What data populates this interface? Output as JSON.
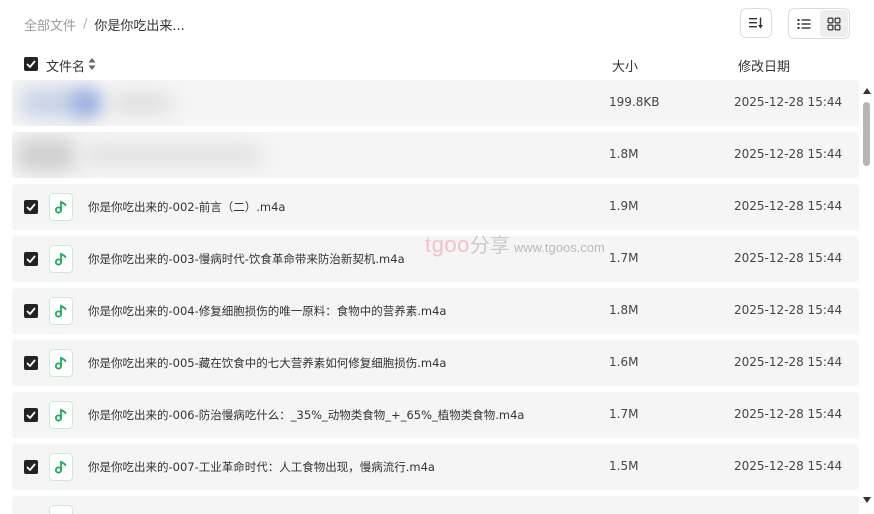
{
  "breadcrumb": {
    "root": "全部文件",
    "separator": "/",
    "current": "你是你吃出来..."
  },
  "columns": {
    "name": "文件名",
    "size": "大小",
    "date": "修改日期"
  },
  "watermark": {
    "logo": "tgoo",
    "cn": "分享",
    "url": "www.tgoos.com"
  },
  "colors": {
    "accent_green": "#1aad5b",
    "row_bg": "#f5f5f5",
    "checkbox": "#222222"
  },
  "rows": [
    {
      "name": "",
      "size": "199.8KB",
      "date": "2025-12-28 15:44",
      "checked": false,
      "blurred": true
    },
    {
      "name": "",
      "size": "1.8M",
      "date": "2025-12-28 15:44",
      "checked": false,
      "blurred": true
    },
    {
      "name": "你是你吃出来的-002-前言（二）.m4a",
      "size": "1.9M",
      "date": "2025-12-28 15:44",
      "checked": true
    },
    {
      "name": "你是你吃出来的-003-慢病时代-饮食革命带来防治新契机.m4a",
      "size": "1.7M",
      "date": "2025-12-28 15:44",
      "checked": true
    },
    {
      "name": "你是你吃出来的-004-修复细胞损伤的唯一原料：食物中的营养素.m4a",
      "size": "1.8M",
      "date": "2025-12-28 15:44",
      "checked": true
    },
    {
      "name": "你是你吃出来的-005-藏在饮食中的七大营养素如何修复细胞损伤.m4a",
      "size": "1.6M",
      "date": "2025-12-28 15:44",
      "checked": true
    },
    {
      "name": "你是你吃出来的-006-防治慢病吃什么：_35%_动物类食物_+_65%_植物类食物.m4a",
      "size": "1.7M",
      "date": "2025-12-28 15:44",
      "checked": true
    },
    {
      "name": "你是你吃出来的-007-工业革命时代：人工食物出现，慢病流行.m4a",
      "size": "1.5M",
      "date": "2025-12-28 15:44",
      "checked": true
    }
  ]
}
